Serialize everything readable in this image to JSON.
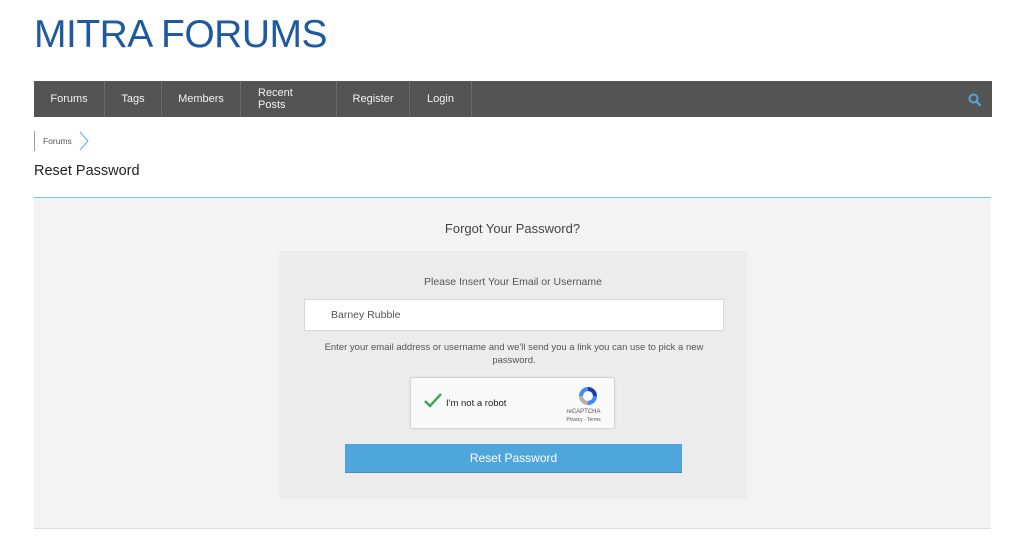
{
  "site": {
    "title": "MITRA FORUMS",
    "brand_color": "#1e5aa0"
  },
  "nav": {
    "items": [
      {
        "label": "Forums"
      },
      {
        "label": "Tags"
      },
      {
        "label": "Members"
      },
      {
        "label": "Recent Posts"
      },
      {
        "label": "Register"
      },
      {
        "label": "Login"
      }
    ],
    "search_icon": "search-icon",
    "background": "#545454",
    "accent": "#4fa6dd"
  },
  "breadcrumb": {
    "items": [
      {
        "label": "Forums"
      }
    ]
  },
  "page": {
    "title": "Reset Password"
  },
  "form": {
    "heading": "Forgot Your Password?",
    "field_label": "Please Insert Your Email or Username",
    "field_value": "Barney Rubble",
    "help_text": "Enter your email address or username and we'll send you a link you can use to pick a new password.",
    "captcha": {
      "label": "I'm not a robot",
      "checked": true,
      "brand": "reCAPTCHA",
      "links": "Privacy - Terms"
    },
    "submit_label": "Reset Password"
  }
}
